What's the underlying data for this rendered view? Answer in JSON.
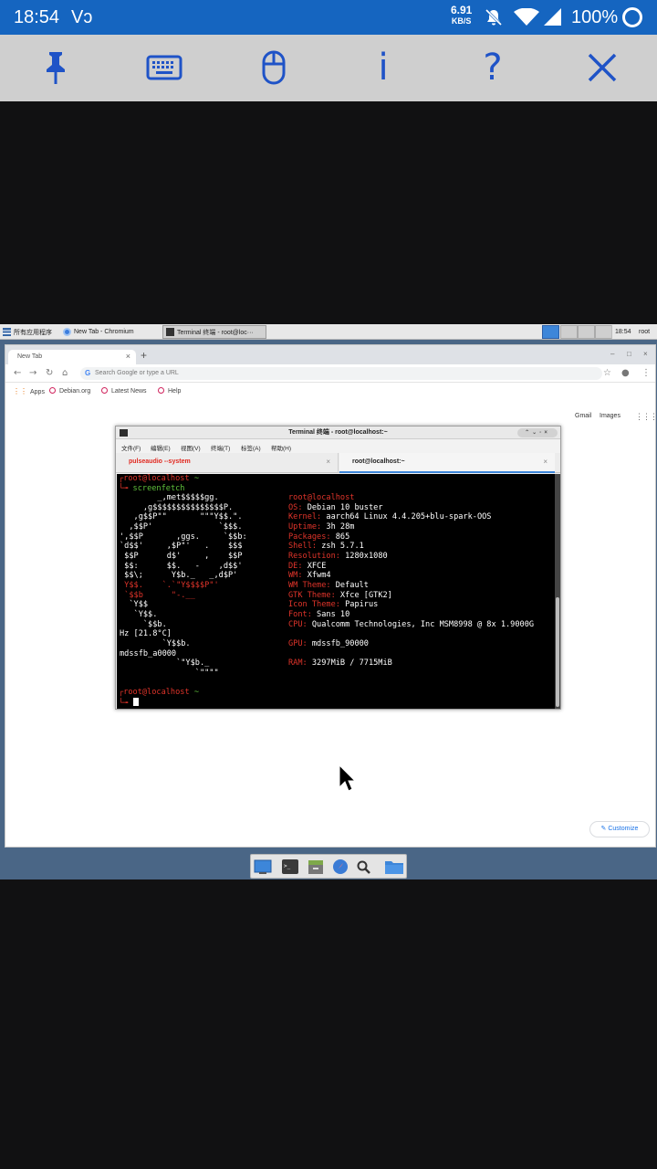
{
  "status_bar": {
    "time": "18:54",
    "vo": "Vɔ",
    "net_speed_value": "6.91",
    "net_speed_unit": "KB/S",
    "battery": "100%",
    "icons": [
      "mute-bell-icon",
      "wifi-icon",
      "signal-icon",
      "battery-circle-icon"
    ]
  },
  "vnc_toolbar": {
    "buttons": [
      {
        "name": "pin",
        "icon": "pin-icon"
      },
      {
        "name": "keyboard",
        "icon": "keyboard-icon"
      },
      {
        "name": "mouse",
        "icon": "mouse-icon"
      },
      {
        "name": "info",
        "label": "i"
      },
      {
        "name": "help",
        "label": "?"
      },
      {
        "name": "close",
        "icon": "close-icon"
      }
    ],
    "accent": "#1f53c7"
  },
  "taskbar": {
    "apps_menu": "所有应用程序",
    "items": [
      {
        "label": "New Tab - Chromium",
        "active": false
      },
      {
        "label": "Terminal 终端 - root@loc···",
        "active": true
      }
    ],
    "clock": "18:54",
    "user": "root"
  },
  "browser": {
    "tab_title": "New Tab",
    "new_tab": "+",
    "window_buttons": [
      "–",
      "□",
      "×"
    ],
    "omnibox_placeholder": "Search Google or type a URL",
    "bookmarks": [
      "Apps",
      "Debian.org",
      "Latest News",
      "Help"
    ],
    "top_links": [
      "Gmail",
      "Images"
    ],
    "customize": "Customize"
  },
  "terminal": {
    "title": "Terminal 终端 - root@localhost:~",
    "menu": [
      "文件(F)",
      "编辑(E)",
      "视图(V)",
      "终端(T)",
      "标签(A)",
      "帮助(H)"
    ],
    "tabs": [
      "pulseaudio --system",
      "root@localhost:~"
    ],
    "prompt_user": "root@localhost",
    "prompt_path": "~",
    "command": "screenfetch",
    "ascii_art": [
      "        _,met$$$$$gg.",
      "     ,g$$$$$$$$$$$$$$$P.",
      "   ,g$$P\"\"       \"\"\"Y$$.\".",
      "  ,$$P'              `$$$.",
      "',$$P       ,ggs.     `$$b:",
      "`d$$'     ,$P\"'   .    $$$",
      " $$P      d$'     ,    $$P",
      " $$:      $$.   -    ,d$$'",
      " $$\\;      Y$b._   _,d$P'",
      " Y$$.    `.`\"Y$$$$P\"'",
      " `$$b      \"-.__",
      "  `Y$$",
      "   `Y$$.",
      "     `$$b.",
      "Hz [21.8°C]",
      "         `Y$$b.",
      "mdssfb_a0000",
      "            `\"Y$b._",
      "                `\"\"\"\""
    ],
    "info": [
      {
        "label": "",
        "value": "root@localhost",
        "header": true
      },
      {
        "label": "OS:",
        "value": "Debian 10 buster"
      },
      {
        "label": "Kernel:",
        "value": "aarch64 Linux 4.4.205+blu-spark-OOS"
      },
      {
        "label": "Uptime:",
        "value": "3h 28m"
      },
      {
        "label": "Packages:",
        "value": "865"
      },
      {
        "label": "Shell:",
        "value": "zsh 5.7.1"
      },
      {
        "label": "Resolution:",
        "value": "1280x1080"
      },
      {
        "label": "DE:",
        "value": "XFCE"
      },
      {
        "label": "WM:",
        "value": "Xfwm4"
      },
      {
        "label": "WM Theme:",
        "value": "Default"
      },
      {
        "label": "GTK Theme:",
        "value": "Xfce [GTK2]"
      },
      {
        "label": "Icon Theme:",
        "value": "Papirus"
      },
      {
        "label": "Font:",
        "value": "Sans 10"
      },
      {
        "label": "CPU:",
        "value": "Qualcomm Technologies, Inc MSM8998 @ 8x 1.9000G"
      },
      {
        "label": "",
        "value": ""
      },
      {
        "label": "GPU:",
        "value": "mdssfb_90000"
      },
      {
        "label": "",
        "value": ""
      },
      {
        "label": "RAM:",
        "value": "3297MiB / 7715MiB"
      }
    ]
  },
  "dock": [
    "desktop-icon",
    "terminal-icon",
    "file-manager-icon",
    "web-browser-icon",
    "search-icon",
    "folder-icon"
  ]
}
